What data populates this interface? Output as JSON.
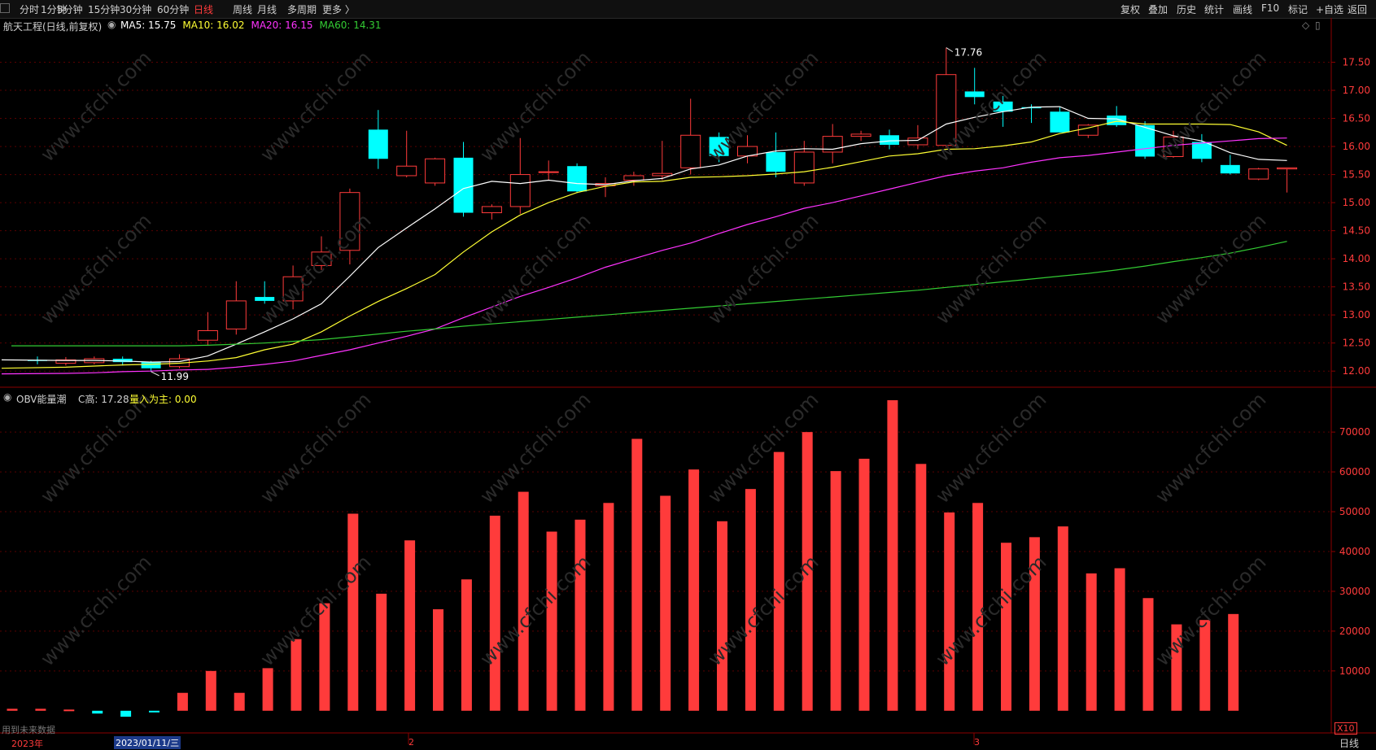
{
  "toolbar": {
    "left_tabs": [
      {
        "label": "分时",
        "active": false
      },
      {
        "label": "1分钟",
        "active": false
      },
      {
        "label": "5分钟",
        "active": false
      },
      {
        "label": "15分钟",
        "active": false
      },
      {
        "label": "30分钟",
        "active": false
      },
      {
        "label": "60分钟",
        "active": false
      },
      {
        "label": "日线",
        "active": true
      },
      {
        "label": "周线",
        "active": false
      },
      {
        "label": "月线",
        "active": false
      },
      {
        "label": "多周期",
        "active": false
      },
      {
        "label": "更多 〉",
        "active": false
      }
    ],
    "right_buttons": [
      "复权",
      "叠加",
      "历史",
      "统计",
      "画线",
      "F10",
      "标记",
      "+自选",
      "返回"
    ]
  },
  "main_panel": {
    "stock_label": "航天工程(日线,前复权)",
    "ma_labels": [
      {
        "text": "MA5: 15.75",
        "color": "#ffffff"
      },
      {
        "text": "MA10: 16.02",
        "color": "#ffff33"
      },
      {
        "text": "MA20: 16.15",
        "color": "#ff33ff"
      },
      {
        "text": "MA60: 14.31",
        "color": "#33cc33"
      }
    ],
    "high_marker": "17.76",
    "low_marker": "11.99"
  },
  "sub_panel": {
    "name": "OBV能量潮",
    "c_label": "C高: 17.28",
    "main_flow_label": "量入为主: 0.00",
    "future_note": "用到未来数据",
    "unit_label": "X10"
  },
  "bottom_bar": {
    "year_label": "2023年",
    "date_label": "2023/01/11/三",
    "month_markers": [
      "2",
      "3"
    ],
    "period_label": "日线"
  },
  "watermark": "www.cfchi.com",
  "colors": {
    "up": "#ff3b3b",
    "down": "#00ffff",
    "grid": "#5a0000",
    "ma5": "#ffffff",
    "ma10": "#ffff33",
    "ma20": "#ff33ff",
    "ma60": "#33cc33"
  },
  "chart_data": [
    {
      "type": "candlestick",
      "title": "航天工程(日线,前复权)",
      "y_ticks": [
        12.0,
        12.5,
        13.0,
        13.5,
        14.0,
        14.5,
        15.0,
        15.5,
        16.0,
        16.5,
        17.0,
        17.5
      ],
      "ylim": [
        11.8,
        18.0
      ],
      "candles": [
        {
          "o": 12.2,
          "h": 12.26,
          "l": 12.12,
          "c": 12.18
        },
        {
          "o": 12.14,
          "h": 12.25,
          "l": 12.1,
          "c": 12.2
        },
        {
          "o": 12.15,
          "h": 12.26,
          "l": 12.12,
          "c": 12.22
        },
        {
          "o": 12.22,
          "h": 12.26,
          "l": 12.1,
          "c": 12.16
        },
        {
          "o": 12.16,
          "h": 12.18,
          "l": 11.99,
          "c": 12.05
        },
        {
          "o": 12.08,
          "h": 12.3,
          "l": 12.05,
          "c": 12.22
        },
        {
          "o": 12.55,
          "h": 13.05,
          "l": 12.45,
          "c": 12.72
        },
        {
          "o": 12.75,
          "h": 13.6,
          "l": 12.65,
          "c": 13.25
        },
        {
          "o": 13.32,
          "h": 13.6,
          "l": 13.2,
          "c": 13.25
        },
        {
          "o": 13.25,
          "h": 13.88,
          "l": 13.1,
          "c": 13.68
        },
        {
          "o": 13.88,
          "h": 14.4,
          "l": 13.8,
          "c": 14.12
        },
        {
          "o": 14.15,
          "h": 15.25,
          "l": 13.9,
          "c": 15.18
        },
        {
          "o": 16.3,
          "h": 16.65,
          "l": 15.6,
          "c": 15.78
        },
        {
          "o": 15.48,
          "h": 16.28,
          "l": 15.45,
          "c": 15.65
        },
        {
          "o": 15.35,
          "h": 15.8,
          "l": 15.3,
          "c": 15.78
        },
        {
          "o": 15.8,
          "h": 16.08,
          "l": 14.75,
          "c": 14.82
        },
        {
          "o": 14.82,
          "h": 14.97,
          "l": 14.7,
          "c": 14.93
        },
        {
          "o": 14.93,
          "h": 16.15,
          "l": 14.8,
          "c": 15.5
        },
        {
          "o": 15.55,
          "h": 15.75,
          "l": 15.4,
          "c": 15.55
        },
        {
          "o": 15.65,
          "h": 15.7,
          "l": 15.17,
          "c": 15.2
        },
        {
          "o": 15.3,
          "h": 15.45,
          "l": 15.1,
          "c": 15.34
        },
        {
          "o": 15.4,
          "h": 15.55,
          "l": 15.3,
          "c": 15.48
        },
        {
          "o": 15.48,
          "h": 16.1,
          "l": 15.4,
          "c": 15.52
        },
        {
          "o": 15.62,
          "h": 16.85,
          "l": 15.5,
          "c": 16.2
        },
        {
          "o": 16.17,
          "h": 16.25,
          "l": 15.72,
          "c": 15.83
        },
        {
          "o": 15.83,
          "h": 16.2,
          "l": 15.7,
          "c": 16.0
        },
        {
          "o": 15.9,
          "h": 16.25,
          "l": 15.45,
          "c": 15.55
        },
        {
          "o": 15.35,
          "h": 16.1,
          "l": 15.3,
          "c": 15.9
        },
        {
          "o": 15.9,
          "h": 16.4,
          "l": 15.7,
          "c": 16.18
        },
        {
          "o": 16.18,
          "h": 16.28,
          "l": 16.1,
          "c": 16.22
        },
        {
          "o": 16.2,
          "h": 16.3,
          "l": 15.95,
          "c": 16.03
        },
        {
          "o": 16.03,
          "h": 16.38,
          "l": 15.95,
          "c": 16.15
        },
        {
          "o": 16.02,
          "h": 17.76,
          "l": 15.98,
          "c": 17.28
        },
        {
          "o": 16.98,
          "h": 17.4,
          "l": 16.75,
          "c": 16.88
        },
        {
          "o": 16.8,
          "h": 16.9,
          "l": 16.35,
          "c": 16.62
        },
        {
          "o": 16.7,
          "h": 16.75,
          "l": 16.42,
          "c": 16.68
        },
        {
          "o": 16.62,
          "h": 16.7,
          "l": 16.25,
          "c": 16.25
        },
        {
          "o": 16.2,
          "h": 16.4,
          "l": 16.15,
          "c": 16.38
        },
        {
          "o": 16.55,
          "h": 16.72,
          "l": 16.35,
          "c": 16.38
        },
        {
          "o": 16.38,
          "h": 16.45,
          "l": 15.78,
          "c": 15.82
        },
        {
          "o": 15.82,
          "h": 16.28,
          "l": 15.8,
          "c": 16.17
        },
        {
          "o": 16.08,
          "h": 16.22,
          "l": 15.72,
          "c": 15.78
        },
        {
          "o": 15.67,
          "h": 15.85,
          "l": 15.5,
          "c": 15.52
        },
        {
          "o": 15.42,
          "h": 15.62,
          "l": 15.4,
          "c": 15.6
        },
        {
          "o": 15.6,
          "h": 15.62,
          "l": 15.18,
          "c": 15.62
        }
      ],
      "series": [
        {
          "name": "MA5",
          "values": [
            12.2,
            12.19,
            12.19,
            12.18,
            12.16,
            12.17,
            12.27,
            12.48,
            12.7,
            12.93,
            13.2,
            13.69,
            14.2,
            14.55,
            14.89,
            15.25,
            15.38,
            15.34,
            15.4,
            15.34,
            15.32,
            15.39,
            15.43,
            15.6,
            15.67,
            15.83,
            15.92,
            15.96,
            15.95,
            16.05,
            16.1,
            16.11,
            16.4,
            16.52,
            16.62,
            16.7,
            16.71,
            16.5,
            16.49,
            16.34,
            16.19,
            16.1,
            15.89,
            15.77,
            15.75
          ]
        },
        {
          "name": "MA10",
          "values": [
            12.05,
            12.07,
            12.09,
            12.11,
            12.12,
            12.14,
            12.18,
            12.24,
            12.38,
            12.48,
            12.7,
            12.98,
            13.24,
            13.47,
            13.72,
            14.12,
            14.48,
            14.78,
            15.0,
            15.18,
            15.29,
            15.37,
            15.38,
            15.45,
            15.46,
            15.48,
            15.51,
            15.55,
            15.63,
            15.73,
            15.83,
            15.87,
            15.95,
            15.96,
            16.01,
            16.08,
            16.23,
            16.33,
            16.45,
            16.4,
            16.4,
            16.4,
            16.39,
            16.26,
            16.02
          ]
        },
        {
          "name": "MA20",
          "values": [
            11.95,
            11.96,
            11.97,
            11.99,
            12.0,
            12.02,
            12.03,
            12.07,
            12.12,
            12.18,
            12.28,
            12.38,
            12.5,
            12.62,
            12.75,
            12.95,
            13.14,
            13.33,
            13.49,
            13.66,
            13.85,
            14.0,
            14.15,
            14.28,
            14.45,
            14.61,
            14.75,
            14.9,
            15.0,
            15.12,
            15.24,
            15.36,
            15.48,
            15.56,
            15.62,
            15.72,
            15.8,
            15.84,
            15.9,
            15.96,
            16.02,
            16.06,
            16.1,
            16.14,
            16.15
          ]
        },
        {
          "name": "MA60",
          "values": [
            12.45,
            12.45,
            12.45,
            12.45,
            12.45,
            12.45,
            12.46,
            12.48,
            12.5,
            12.53,
            12.56,
            12.61,
            12.66,
            12.71,
            12.75,
            12.8,
            12.84,
            12.88,
            12.92,
            12.96,
            13.0,
            13.04,
            13.08,
            13.12,
            13.16,
            13.2,
            13.24,
            13.28,
            13.32,
            13.36,
            13.4,
            13.44,
            13.49,
            13.54,
            13.59,
            13.64,
            13.69,
            13.74,
            13.8,
            13.87,
            13.95,
            14.02,
            14.1,
            14.2,
            14.31
          ]
        }
      ]
    },
    {
      "type": "bar",
      "title": "OBV能量潮",
      "y_ticks": [
        10000,
        20000,
        30000,
        40000,
        50000,
        60000,
        70000
      ],
      "ylim": [
        -2500,
        78000
      ],
      "values": [
        500,
        500,
        300,
        -700,
        -1500,
        -300,
        4500,
        10000,
        4500,
        10700,
        18000,
        27000,
        49500,
        29400,
        42800,
        25500,
        33000,
        49000,
        55000,
        45000,
        48000,
        52200,
        68300,
        54000,
        60600,
        47600,
        55700,
        65000,
        70000,
        60200,
        63300,
        78000,
        62000,
        49800,
        52200,
        42200,
        43600,
        46300,
        34500,
        35800,
        28300,
        21700,
        22800,
        24300
      ]
    }
  ]
}
